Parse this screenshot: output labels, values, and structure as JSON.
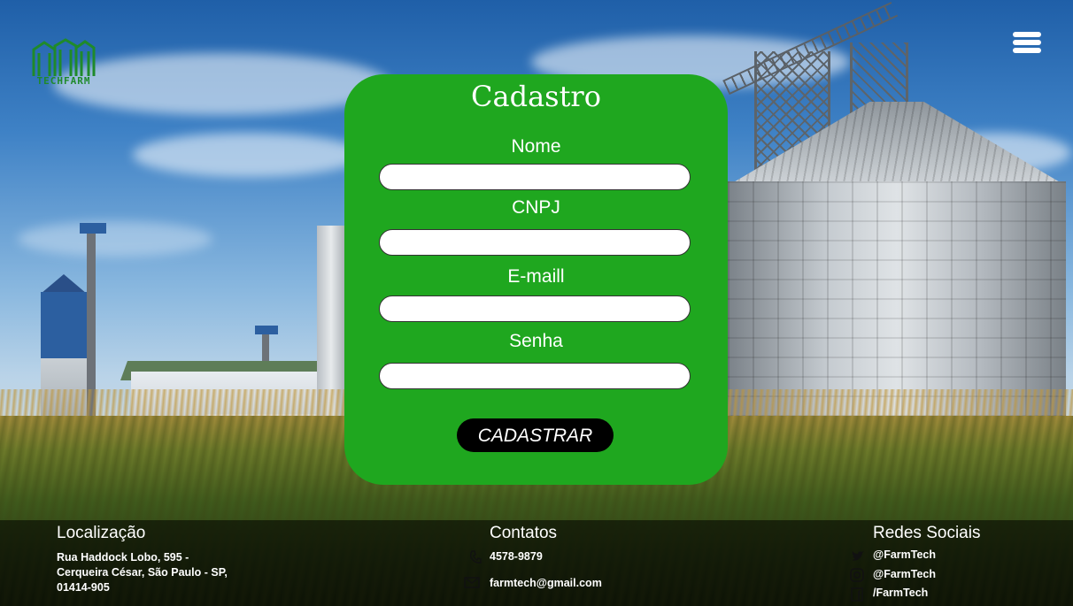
{
  "logo": {
    "text": "TECHFARM",
    "icon": "silos-logo-icon",
    "color": "#1f8a2a"
  },
  "menu": {
    "icon": "hamburger-menu-icon"
  },
  "form": {
    "title": "Cadastro",
    "accent": "#1fa71f",
    "fields": [
      {
        "label": "Nome",
        "value": "",
        "placeholder": ""
      },
      {
        "label": "CNPJ",
        "value": "",
        "placeholder": ""
      },
      {
        "label": "E-maill",
        "value": "",
        "placeholder": ""
      },
      {
        "label": "Senha",
        "value": "",
        "placeholder": ""
      }
    ],
    "submit_label": "CADASTRAR"
  },
  "footer": {
    "location": {
      "heading": "Localização",
      "lines": [
        "Rua Haddock Lobo, 595 -",
        "Cerqueira César, São Paulo - SP,",
        "01414-905"
      ]
    },
    "contacts": {
      "heading": "Contatos",
      "phone": {
        "icon": "phone-icon",
        "text": "4578-9879"
      },
      "email": {
        "icon": "mail-icon",
        "text": "farmtech@gmail.com"
      }
    },
    "social": {
      "heading": "Redes Sociais",
      "items": [
        {
          "icon": "twitter-icon",
          "text": "@FarmTech"
        },
        {
          "icon": "instagram-icon",
          "text": "@FarmTech"
        },
        {
          "icon": "facebook-icon",
          "text": "/FarmTech"
        }
      ]
    }
  }
}
